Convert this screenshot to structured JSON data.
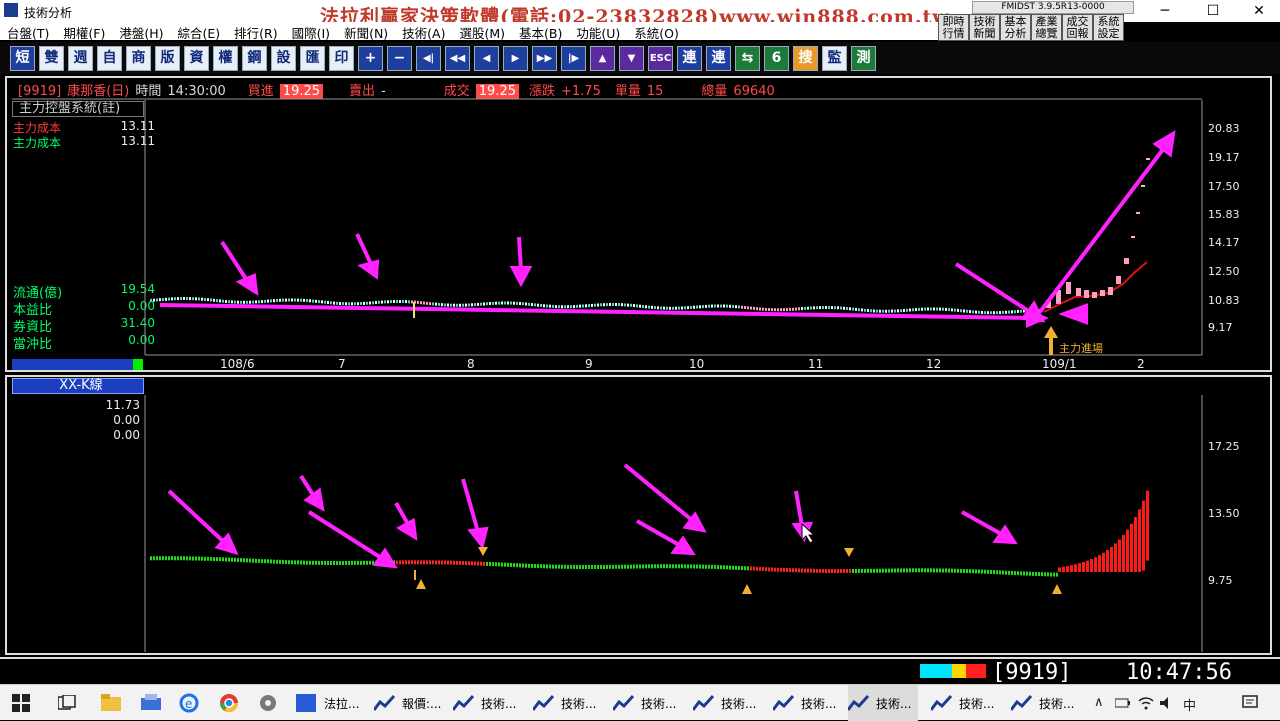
{
  "window": {
    "title": "技術分析",
    "promo": "法拉利贏家決策軟體(電話:02-23832828)www.win888.com.tw",
    "version": "FMIDST 3.9.5R13-0000",
    "quick_buttons": [
      {
        "top": "即時",
        "bottom": "行情"
      },
      {
        "top": "技術",
        "bottom": "新聞"
      },
      {
        "top": "基本",
        "bottom": "分析"
      },
      {
        "top": "產業",
        "bottom": "分析"
      },
      {
        "top": "成交",
        "bottom": "總覽"
      },
      {
        "top": "系統",
        "bottom": "回報"
      }
    ],
    "quick_labels_row2": [
      "行情",
      "新聞",
      "分析",
      "總覽",
      "回報",
      "設定"
    ],
    "controls": {
      "minimize": "─",
      "maximize": "☐",
      "close": "✕"
    }
  },
  "menu": [
    "台盤(T)",
    "期權(F)",
    "港盤(H)",
    "綜合(E)",
    "排行(R)",
    "國際(I)",
    "新聞(N)",
    "技術(A)",
    "選股(M)",
    "基本(B)",
    "功能(U)",
    "系統(O)"
  ],
  "toolbar": [
    "短",
    "雙",
    "週",
    "自",
    "商",
    "版",
    "資",
    "權",
    "鋼",
    "設",
    "匯",
    "印",
    "+",
    "−",
    "◀|",
    "◀◀",
    "◀",
    "▶",
    "▶▶",
    "|▶",
    "▲",
    "▼",
    "ESC",
    "連",
    "連",
    "⇆",
    "6",
    "搜",
    "監",
    "測"
  ],
  "quote": {
    "code": "[9919]",
    "name": "康那香(日)",
    "time_label": "時間",
    "time": "14:30:00",
    "bid_label": "買進",
    "bid": "19.25",
    "ask_label": "賣出",
    "ask": "-",
    "last_label": "成交",
    "last": "19.25",
    "change_label": "漲跌",
    "change": "+1.75",
    "vol_label": "單量",
    "vol": "15",
    "total_label": "總量",
    "total": "69640"
  },
  "upper_panel": {
    "tag": "主力控盤系統(註)",
    "indicators": [
      {
        "name": "主力成本",
        "value": "13.11",
        "color": "#ff3b3b"
      },
      {
        "name": "主力成本",
        "value": "13.11",
        "color": "#00ff66"
      }
    ],
    "stats": [
      {
        "name": "流通(億)",
        "value": "19.54"
      },
      {
        "name": "本益比",
        "value": "0.00"
      },
      {
        "name": "券資比",
        "value": "31.40"
      },
      {
        "name": "當沖比",
        "value": "0.00"
      }
    ],
    "yaxis": [
      "20.83",
      "19.17",
      "17.50",
      "15.83",
      "14.17",
      "12.50",
      "10.83",
      "9.17"
    ],
    "xaxis": [
      "108/6",
      "7",
      "8",
      "9",
      "10",
      "11",
      "12",
      "109/1",
      "2"
    ],
    "annotation": "主力進場"
  },
  "lower_panel": {
    "tag": "XX-K線",
    "values": [
      "11.73",
      "0.00",
      "0.00"
    ],
    "yaxis": [
      "17.25",
      "13.50",
      "9.75"
    ]
  },
  "status": {
    "code": "9919",
    "clock": "10:47:56"
  },
  "taskbar": {
    "items": [
      "法拉...",
      "報價:...",
      "技術...",
      "技術...",
      "技術...",
      "技術...",
      "技術...",
      "技術...",
      "技術...",
      "技術..."
    ],
    "ime": "中"
  },
  "colors": {
    "up": "#ff3b3b",
    "down": "#00ff66",
    "arrow": "#ff22ff",
    "entry": "#f0b030"
  }
}
